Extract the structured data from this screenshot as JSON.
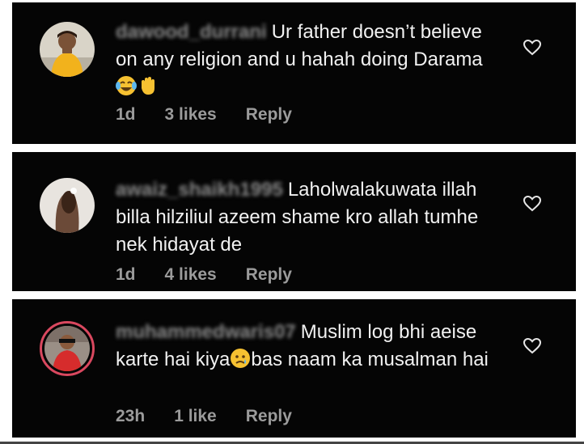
{
  "comments": [
    {
      "username": "dawood_durrani",
      "text": "Ur father  doesn’t believe on any religion and u hahah doing Darama",
      "time": "1d",
      "likes": "3 likes",
      "reply": "Reply",
      "emojis": [
        "face-with-tears-of-joy",
        "waving-hand"
      ]
    },
    {
      "username": "awaiz_shaikh1995",
      "text": "Laholwalakuwata illah billa hilziliul azeem shame kro allah tumhe nek hidayat de",
      "time": "1d",
      "likes": "4 likes",
      "reply": "Reply",
      "emojis": []
    },
    {
      "username": "muhammedwaris07",
      "text_before": "Muslim log bhi aeise karte hai kiya",
      "text_after": "bas naam ka musalman hai",
      "time": "23h",
      "likes": "1 like",
      "reply": "Reply",
      "emojis": [
        "crying-face"
      ]
    }
  ],
  "colors": {
    "card_bg": "#050505",
    "text": "#f1f1f1",
    "meta": "#9b9b9b",
    "story_ring": "#d9485f"
  }
}
